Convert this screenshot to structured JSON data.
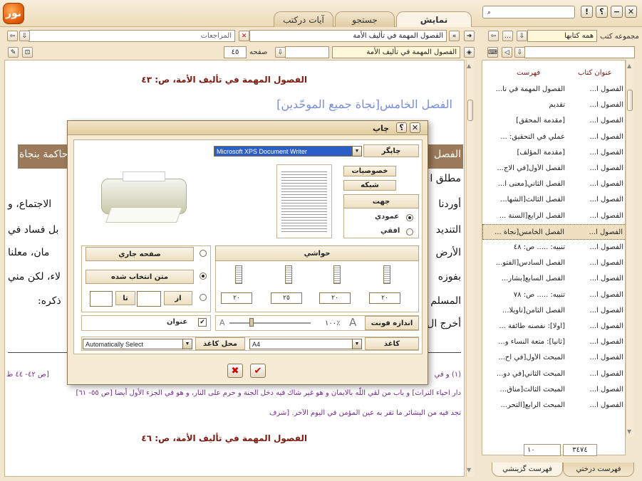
{
  "tabs": [
    {
      "label": "نمایش"
    },
    {
      "label": "جستجو"
    },
    {
      "label": "آیات درکتب"
    }
  ],
  "logo": "نور",
  "window_buttons": [
    "✕",
    "−",
    "؟",
    "!"
  ],
  "toolbar": {
    "book_title": "الفصول المهمة في تأليف الأمة",
    "ref_label": "المراجعات",
    "book_title_2": "الفصول المهمة في تأليف الأمة",
    "page_label": "صفحه",
    "page_value": "٤٥"
  },
  "right_toolbar": {
    "collection_label": "مجموعه كتب",
    "collection_value": "همه كتابها"
  },
  "content": {
    "header_top": "الفصول المهمة في تأليف الأمة، ص: ٤٣",
    "chapter_heading": "الفصل الخامس[نجاة جميع الموحّدين]",
    "line_banner_left": "حاكمة بنجاة",
    "line_banner_right": "الفصل",
    "l1_left": "الاجتماع، و",
    "l1_right": "أوردنا",
    "l2_left": "بل فساد في",
    "l2_right": "التنديد",
    "l3_left": "مان، معلنا",
    "l3_right": "الأرض",
    "l4_left": "لاء، لكن مني",
    "l4_right": "بفوزه",
    "l5_left": "ذكره:",
    "l5_right": "المسلم",
    "l6_right": "أخرج ال",
    "l0_right": "مطلق ا",
    "fn1_left": "[ص ٤٢- ٤٤ ط",
    "fn1_right": "(١) و في",
    "fn2": "دار احياء التراث] و باب من لقي اللّه بالايمان و هو غير شاك فيه دخل الجنة و حرم على النار، و هو في الجزء الأول أيضا [ص ٥٥- ٦١]",
    "fn3": "تجد فيه من البشائر ما تقر به عين المؤمن في اليوم الآخر. [شرف",
    "header_bottom": "الفصول المهمة في تأليف الأمة، ص: ٤٦"
  },
  "toc": {
    "col_book": "عنوان كتاب",
    "col_index": "فهرست",
    "rows": [
      {
        "book": "الفصول ا...",
        "title": "الفصول المهمة في تأ..."
      },
      {
        "book": "الفصول ا...",
        "title": "تقديم"
      },
      {
        "book": "الفصول ا...",
        "title": "[مقدمة المحقق]"
      },
      {
        "book": "الفصول ا...",
        "title": "عملي في التحقيق: ..."
      },
      {
        "book": "الفصول ا...",
        "title": "[مقدمة المؤلف]"
      },
      {
        "book": "الفصول ا...",
        "title": "الفصل الأول[في الاج..."
      },
      {
        "book": "الفصول ا...",
        "title": "الفصل الثاني[معنى ا..."
      },
      {
        "book": "الفصول ا...",
        "title": "الفصل الثالث[الشها..."
      },
      {
        "book": "الفصول ا...",
        "title": "الفصل الرابع[السنة ..."
      },
      {
        "book": "الفصول ا...",
        "title": "الفصل الخامس[نجاة ..."
      },
      {
        "book": "الفصول ا...",
        "title": "تنبيه: ..... ص: ٤٨"
      },
      {
        "book": "الفصول ا...",
        "title": "الفصل السادس[الفتو..."
      },
      {
        "book": "الفصول ا...",
        "title": "الفصل السابع[بشار..."
      },
      {
        "book": "الفصول ا...",
        "title": "تنبيه: ..... ص: ٧٨"
      },
      {
        "book": "الفصول ا...",
        "title": "الفصل الثامن[تأويلا..."
      },
      {
        "book": "الفصول ا...",
        "title": "[أولا]: نفصنه طائفة ..."
      },
      {
        "book": "الفصول ا...",
        "title": "[ثانيا]: متعة النساء و..."
      },
      {
        "book": "الفصول ا...",
        "title": "المبحث الأول[في أح..."
      },
      {
        "book": "الفصول ا...",
        "title": "المبحث الثاني[في دو..."
      },
      {
        "book": "الفصول ا...",
        "title": "المبحث الثالث[مناق..."
      },
      {
        "book": "الفصول ا...",
        "title": "المبحث الرابع[التحر..."
      }
    ],
    "count_total": "٣٤٧٤",
    "count_page": "١٠"
  },
  "bottom_tabs": [
    {
      "label": "فهرست درختي"
    },
    {
      "label": "فهرست گزينشي"
    }
  ],
  "print_dialog": {
    "title": "چاپ",
    "printer_label": "چاپگر",
    "printer_value": "Microsoft XPS Document Writer",
    "properties": "خصوصيات",
    "network": "شبكه",
    "orientation_label": "جهت",
    "portrait": "عمودي",
    "landscape": "افقي",
    "current_page": "صفحه جاري",
    "selected_text": "متن انتخاب شده",
    "from_label": "از",
    "to_label": "تا",
    "margins_label": "حواشي",
    "margin_values": [
      "٢٠",
      "٢٥",
      "٢٠",
      "٢٠"
    ],
    "title_check": "عنوان",
    "font_size_label": "اندازه فونت",
    "font_percent": "١٠٠٪",
    "font_a_small": "A",
    "font_a_big": "A",
    "paper_label": "كاغذ",
    "paper_value": "A4",
    "paper_source_label": "محل كاغذ",
    "paper_source_value": "Automatically Select",
    "ok": "✔",
    "cancel": "✖"
  },
  "colors": {
    "accent": "#e8620c",
    "maroon": "#7a1a10",
    "purple": "#7a2a90",
    "heading_blue": "#7a8ed8"
  }
}
